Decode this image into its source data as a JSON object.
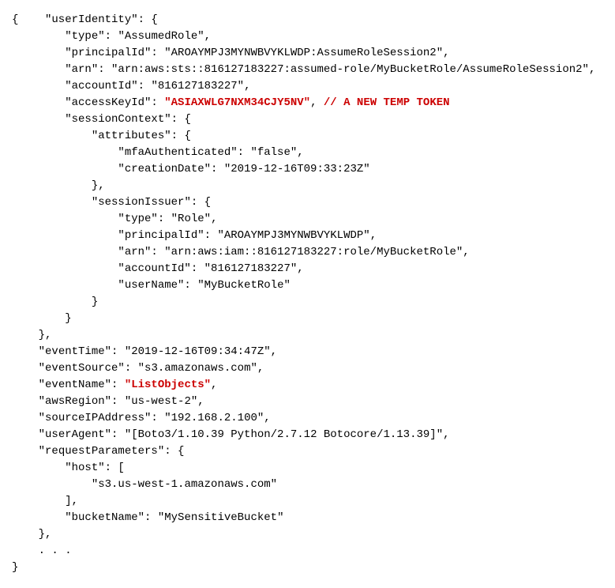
{
  "json": {
    "userIdentity": {
      "type": "AssumedRole",
      "principalId": "AROAYMPJ3MYNWBVYKLWDP:AssumeRoleSession2",
      "arn": "arn:aws:sts::816127183227:assumed-role/MyBucketRole/AssumeRoleSession2",
      "accountId": "816127183227",
      "accessKeyId": "ASIAXWLG7NXM34CJY5NV",
      "sessionContext": {
        "attributes": {
          "mfaAuthenticated": "false",
          "creationDate": "2019-12-16T09:33:23Z"
        },
        "sessionIssuer": {
          "type": "Role",
          "principalId": "AROAYMPJ3MYNWBVYKLWDP",
          "arn": "arn:aws:iam::816127183227:role/MyBucketRole",
          "accountId": "816127183227",
          "userName": "MyBucketRole"
        }
      }
    },
    "eventTime": "2019-12-16T09:34:47Z",
    "eventSource": "s3.amazonaws.com",
    "eventName": "ListObjects",
    "awsRegion": "us-west-2",
    "sourceIPAddress": "192.168.2.100",
    "userAgent": "[Boto3/1.10.39 Python/2.7.12 Botocore/1.13.39]",
    "requestParameters": {
      "host": [
        "s3.us-west-1.amazonaws.com"
      ],
      "bucketName": "MySensitiveBucket"
    }
  },
  "highlights": {
    "accessKeyId": "\"ASIAXWLG7NXM34CJY5NV\"",
    "accessKeyComment": "// A NEW TEMP TOKEN",
    "eventName": "\"ListObjects\""
  }
}
